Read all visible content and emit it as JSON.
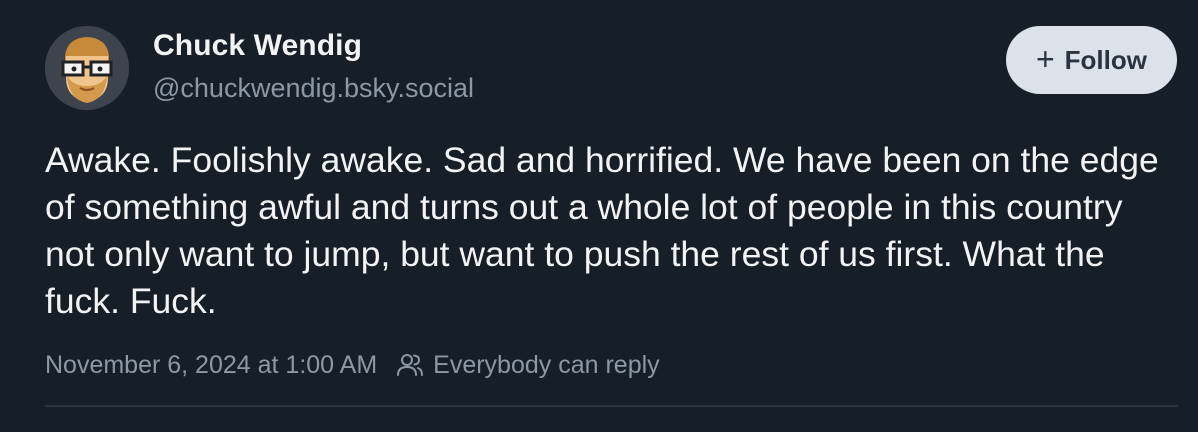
{
  "author": {
    "display_name": "Chuck Wendig",
    "handle": "@chuckwendig.bsky.social",
    "avatar_icon": "bearded-man-with-glasses-avatar"
  },
  "follow_button": {
    "icon": "plus-icon",
    "icon_glyph": "+",
    "label": "Follow"
  },
  "post": {
    "text": "Awake. Foolishly awake. Sad and horrified. We have been on the edge of something awful and turns out a whole lot of people in this country not only want to jump, but want to push the rest of us first. What the fuck. Fuck.",
    "timestamp": "November 6, 2024 at 1:00 AM",
    "reply_setting": "Everybody can reply",
    "reply_icon": "people-icon"
  },
  "colors": {
    "background": "#161e27",
    "primary_text": "#f1f3f5",
    "secondary_text": "#8d98a5",
    "follow_button_bg": "#dce2ea",
    "follow_button_text": "#2a3441"
  }
}
